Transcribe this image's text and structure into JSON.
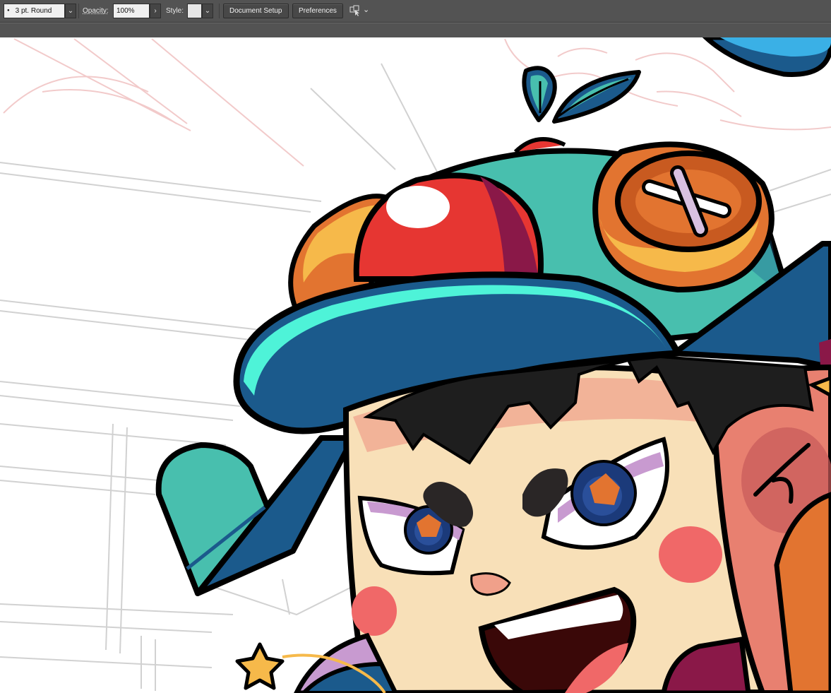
{
  "toolbar": {
    "brush_value": "3 pt. Round",
    "brush_dropdown_icon": "chevron-down-icon",
    "opacity_label": "Opacity:",
    "opacity_value": "100%",
    "opacity_next_icon": "chevron-right-icon",
    "style_label": "Style:",
    "style_dropdown_icon": "chevron-down-icon",
    "document_setup_label": "Document Setup",
    "preferences_label": "Preferences",
    "arrange_icon": "arrange-documents-icon",
    "arrange_dropdown_icon": "chevron-down-icon"
  },
  "colors": {
    "ui_background": "#535353",
    "canvas": "#ffffff",
    "cap_teal": "#48bfae",
    "cap_brim": "#1b5a8c",
    "brim_highlight": "#4ef3d8",
    "skin": "#f8e0b8",
    "red_button": "#e63632",
    "orange_button": "#e27430",
    "blush": "#f06868",
    "hair": "#1e1e1e",
    "outline": "#0a0a0a",
    "sketch_red": "#e58a8a",
    "sketch_gray": "#b8b8b8"
  }
}
